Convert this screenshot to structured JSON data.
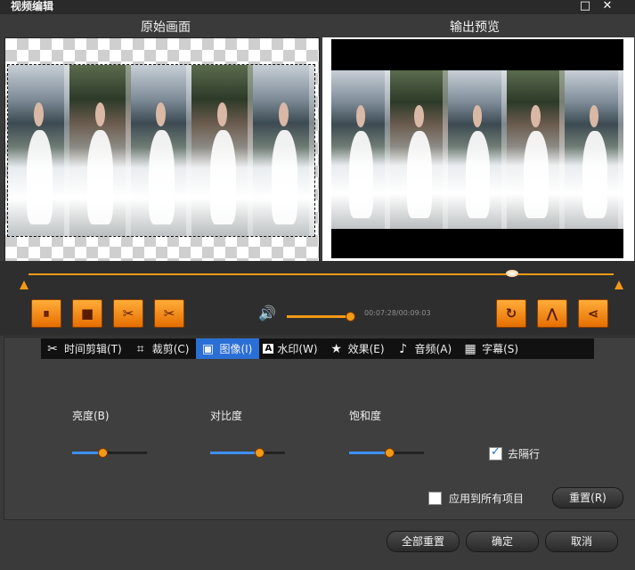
{
  "window": {
    "title": "视频编辑",
    "maximize_glyph": "□",
    "close_glyph": "✕"
  },
  "preview": {
    "original_label": "原始画面",
    "output_label": "输出预览"
  },
  "playback": {
    "pause_glyph": "⏸",
    "stop_glyph": "■",
    "cut_glyph": "✂",
    "split_glyph": "✂",
    "volume_glyph": "🔊",
    "time": "00:07:28/00:09:03",
    "rotate_glyph": "↻",
    "flip_glyph": "⋀",
    "mirror_glyph": "⋖"
  },
  "tabs": [
    {
      "label": "时间剪辑(T)",
      "icon": "scissors-icon",
      "glyph": "✂"
    },
    {
      "label": "裁剪(C)",
      "icon": "crop-icon",
      "glyph": "⌗"
    },
    {
      "label": "图像(I)",
      "icon": "image-icon",
      "glyph": "▣"
    },
    {
      "label": "水印(W)",
      "icon": "text-watermark-icon",
      "glyph": "A"
    },
    {
      "label": "效果(E)",
      "icon": "star-icon",
      "glyph": "★"
    },
    {
      "label": "音频(A)",
      "icon": "music-note-icon",
      "glyph": "♪"
    },
    {
      "label": "字幕(S)",
      "icon": "film-icon",
      "glyph": "▦"
    }
  ],
  "image_settings": {
    "brightness_label": "亮度(B)",
    "contrast_label": "对比度",
    "saturation_label": "饱和度",
    "brightness_value": 0.4,
    "contrast_value": 0.65,
    "saturation_value": 0.53,
    "deinterlace_label": "去隔行",
    "deinterlace_checked": true,
    "apply_all_label": "应用到所有项目",
    "apply_all_checked": false,
    "reset_label": "重置(R)"
  },
  "footer": {
    "reset_all_label": "全部重置",
    "ok_label": "确定",
    "cancel_label": "取消"
  },
  "colors": {
    "accent": "#f39a16",
    "tab_active": "#2a6fd6"
  }
}
